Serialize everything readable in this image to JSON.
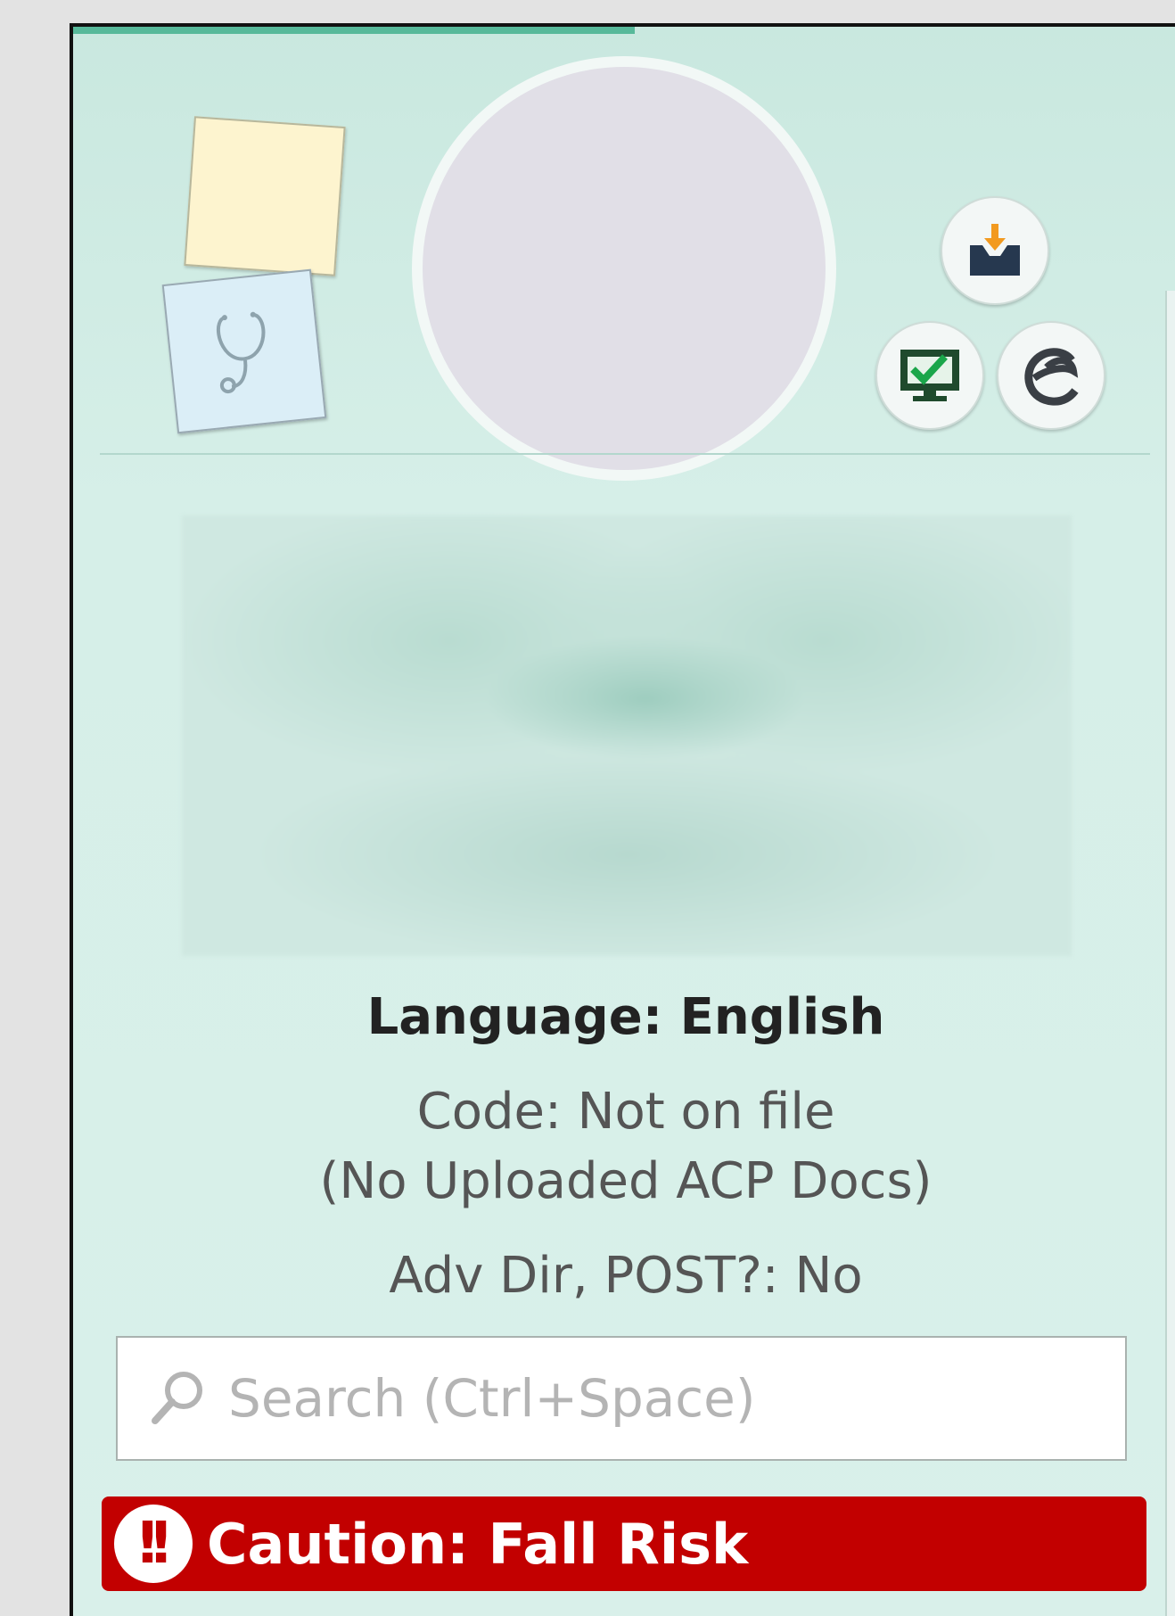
{
  "patient": {
    "language_label": "Language: English",
    "code_status": "Code: Not on file",
    "acp_docs": "(No Uploaded ACP Docs)",
    "adv_dir": "Adv Dir, POST?: No"
  },
  "search": {
    "placeholder": "Search (Ctrl+Space)"
  },
  "alert": {
    "icon_text": "!!",
    "text": "Caution: Fall Risk",
    "color": "#c20000"
  },
  "icons": {
    "sticky_note": "sticky-note-icon",
    "care_team": "stethoscope-icon",
    "inbox": "inbox-download-icon",
    "checklist": "monitor-check-icon",
    "edge": "browser-e-icon",
    "search": "search-icon",
    "alert": "alert-icon"
  },
  "colors": {
    "panel_bg": "#d6efe8",
    "accent": "#57b99a"
  }
}
